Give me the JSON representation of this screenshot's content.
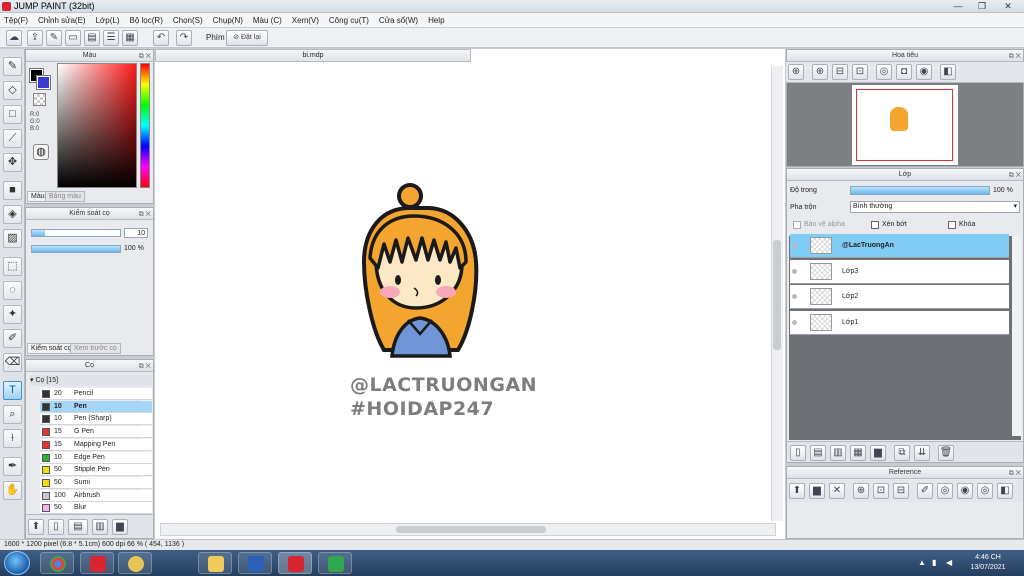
{
  "window": {
    "title": "JUMP PAINT (32bit)",
    "minimize_glyph": "—",
    "maximize_glyph": "❐",
    "close_glyph": "✕"
  },
  "menu": [
    "Tệp(F)",
    "Chỉnh sửa(E)",
    "Lớp(L)",
    "Bộ lọc(R)",
    "Chọn(S)",
    "Chụp(N)",
    "Màu (C)",
    "Xem(V)",
    "Công cụ(T)",
    "Cửa sổ(W)",
    "Help"
  ],
  "toolbar": {
    "snap_label": "Phím",
    "reset_label": "Đặt lại"
  },
  "color_panel": {
    "title": "Màu",
    "rgb_r": "R:0",
    "rgb_g": "G:0",
    "rgb_b": "B:0",
    "tab_color": "Màu",
    "tab_palette": "Bảng màu",
    "foreground": "#000000",
    "background": "#3a3ad0"
  },
  "brush_control": {
    "title": "Kiểm soát cọ",
    "size_value": "10",
    "opacity_value": "100 %",
    "size_fraction": 0.15,
    "opacity_fraction": 1.0,
    "tab_control": "Kiểm soát cọ",
    "tab_preview": "Xem trước cọ"
  },
  "brush_panel": {
    "title": "Cọ",
    "folder_label": "Cọ [15]",
    "items": [
      {
        "size": "20",
        "name": "Pencil",
        "color": "#333333"
      },
      {
        "size": "10",
        "name": "Pen",
        "color": "#333333"
      },
      {
        "size": "10",
        "name": "Pen (Sharp)",
        "color": "#333333"
      },
      {
        "size": "15",
        "name": "G Pen",
        "color": "#e83232"
      },
      {
        "size": "15",
        "name": "Mapping Pen",
        "color": "#e83232"
      },
      {
        "size": "10",
        "name": "Edge Pen",
        "color": "#2bb52b"
      },
      {
        "size": "50",
        "name": "Stipple Pen",
        "color": "#f0e010"
      },
      {
        "size": "50",
        "name": "Sumi",
        "color": "#f0e010"
      },
      {
        "size": "100",
        "name": "Airbrush",
        "color": "#c8c8c8"
      },
      {
        "size": "50",
        "name": "Blur",
        "color": "#f4b4f4"
      }
    ],
    "selected_index": 1
  },
  "document": {
    "tab_name": "bi.mdp",
    "watermark_line1": "@LACTRUONGAN",
    "watermark_line2": "#HOIDAP247"
  },
  "navigator": {
    "title": "Hoa tiêu"
  },
  "layers": {
    "title": "Lớp",
    "opacity_label": "Độ trong",
    "opacity_value": "100 %",
    "opacity_fraction": 1.0,
    "blend_label": "Pha trộn",
    "blend_value": "Bình thường",
    "protect_alpha": "Bảo vệ alpha",
    "clipping": "Xén bớt",
    "lock": "Khóa",
    "items": [
      "@LacTruongAn",
      "Lớp3",
      "Lớp2",
      "Lớp1"
    ],
    "selected_index": 0
  },
  "reference": {
    "title": "Reference"
  },
  "status": {
    "text": "1600 * 1200 pixel   (6.8 * 5.1cm)   600 dpi   66 %   ( 454, 1136 )"
  },
  "taskbar": {
    "time": "4:46 CH",
    "date": "13/07/2021"
  },
  "colors": {
    "accent": "#7fcdf5",
    "selection": "#a6d6f7",
    "hair": "#f4a52f",
    "shirt": "#6f95d6",
    "blush": "#f7a8b8",
    "outline": "#1a1a1a"
  }
}
